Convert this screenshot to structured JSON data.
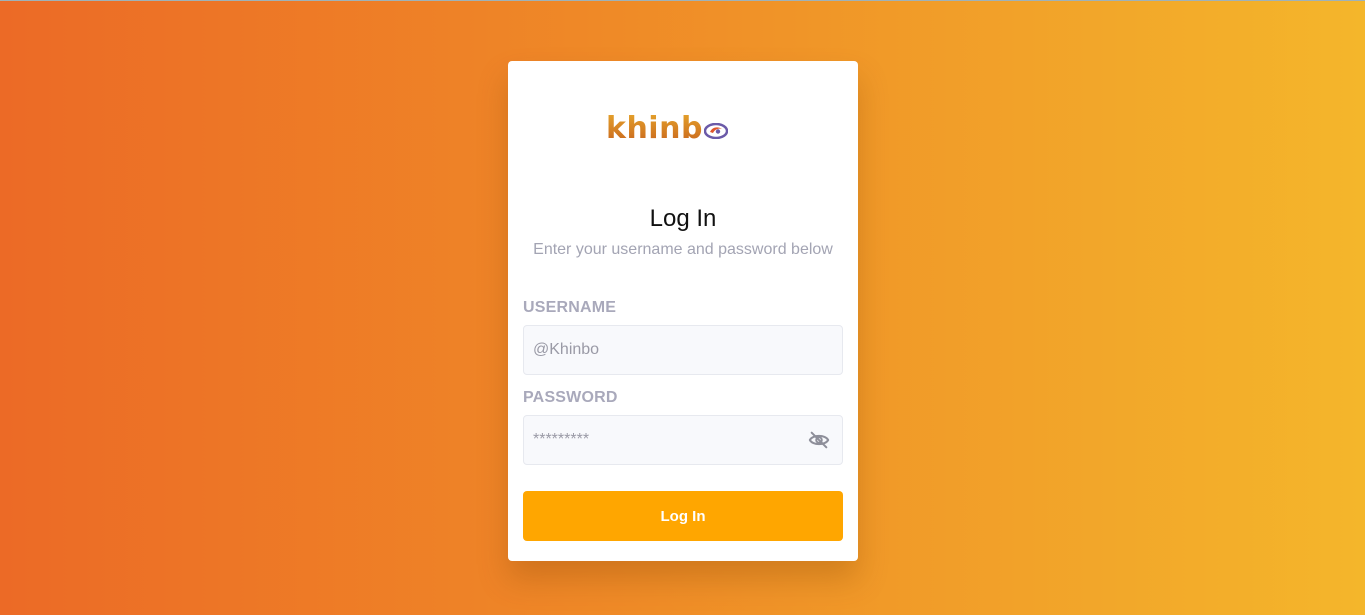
{
  "brand": {
    "logo_text": "khinb",
    "logo_mark": "khinbo-swirl-icon"
  },
  "login": {
    "title": "Log In",
    "subtitle": "Enter your username and password below",
    "username_label": "USERNAME",
    "username_placeholder": "@Khinbo",
    "password_label": "PASSWORD",
    "password_placeholder": "*********",
    "password_toggle_icon": "eye-off-icon",
    "submit_label": "Log In"
  },
  "colors": {
    "background_start": "#ec6a26",
    "background_end": "#f4b62b",
    "button": "#ffa600",
    "label": "#a9a9bb"
  }
}
